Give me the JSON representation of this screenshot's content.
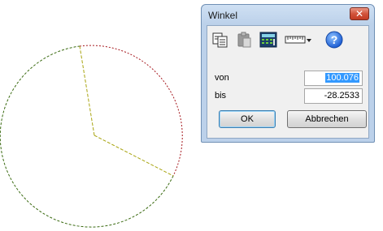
{
  "dialog": {
    "title": "Winkel",
    "close_glyph": "✕",
    "toolbar": [
      "copy-icon",
      "paste-icon",
      "calculator-icon",
      "ruler-dropdown-icon",
      "help-icon"
    ],
    "fields": {
      "von": {
        "label": "von",
        "value": "100.076",
        "selected": true
      },
      "bis": {
        "label": "bis",
        "value": "-28.2533"
      }
    },
    "buttons": {
      "ok": "OK",
      "cancel": "Abbrechen"
    }
  },
  "drawing": {
    "circle_color": "#a6191f",
    "green_color": "#3b6b12",
    "yellow_color": "#a8a410",
    "start_angle_deg": 100.076,
    "end_angle_deg": -28.2533
  }
}
